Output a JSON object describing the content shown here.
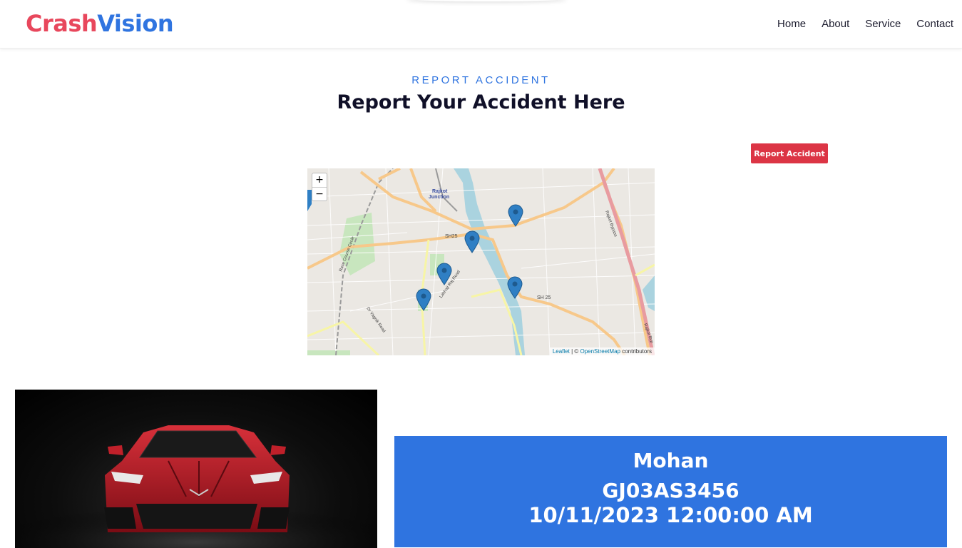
{
  "brand": {
    "part1": "Crash",
    "part2": "Vision",
    "color1": "#e8475c",
    "color2": "#2f74e0"
  },
  "nav": {
    "items": [
      "Home",
      "About",
      "Service",
      "Contact"
    ]
  },
  "section": {
    "eyebrow": "REPORT ACCIDENT",
    "title": "Report Your Accident Here"
  },
  "report_button": {
    "label": "Report Accident",
    "color": "#dc3545"
  },
  "map": {
    "zoom_in": "+",
    "zoom_out": "−",
    "attribution": {
      "leaflet": "Leaflet",
      "separator": " | © ",
      "osm": "OpenStreetMap",
      "suffix": " contributors"
    },
    "labels": [
      "Rajkot Junction",
      "SH25",
      "SH 25",
      "Rajkot Bypass",
      "Lakhaji Raj Road",
      "Dr Yagnik Road",
      "Race Course Circle",
      "Rajkot Byp"
    ],
    "marker_icon": "map-pin-icon",
    "marker_color": "#2f7fc4",
    "marker_count": 5
  },
  "accident": {
    "name": "Mohan",
    "vehicle_number": "GJ03AS3456",
    "datetime": "10/11/2023 12:00:00 AM"
  },
  "image": {
    "subject": "red sports car front view"
  }
}
